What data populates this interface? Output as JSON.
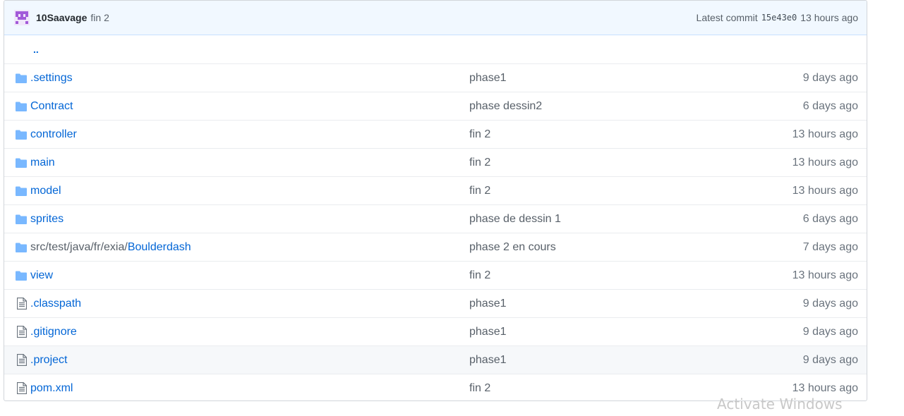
{
  "commit": {
    "author": "10Saavage",
    "message": "fin 2",
    "latest_label": "Latest commit",
    "sha": "15e43e0",
    "age": "13 hours ago"
  },
  "parent_dir": "..",
  "entries": [
    {
      "type": "dir",
      "name": ".settings",
      "message": "phase1",
      "age": "9 days ago"
    },
    {
      "type": "dir",
      "name": "Contract",
      "message": "phase dessin2",
      "age": "6 days ago"
    },
    {
      "type": "dir",
      "name": "controller",
      "message": "fin 2",
      "age": "13 hours ago"
    },
    {
      "type": "dir",
      "name": "main",
      "message": "fin 2",
      "age": "13 hours ago"
    },
    {
      "type": "dir",
      "name": "model",
      "message": "fin 2",
      "age": "13 hours ago"
    },
    {
      "type": "dir",
      "name": "sprites",
      "message": "phase de dessin 1",
      "age": "6 days ago"
    },
    {
      "type": "dir",
      "name_prefix": "src/test/java/fr/exia/",
      "name": "Boulderdash",
      "message": "phase 2 en cours",
      "age": "7 days ago"
    },
    {
      "type": "dir",
      "name": "view",
      "message": "fin 2",
      "age": "13 hours ago"
    },
    {
      "type": "file",
      "name": ".classpath",
      "message": "phase1",
      "age": "9 days ago"
    },
    {
      "type": "file",
      "name": ".gitignore",
      "message": "phase1",
      "age": "9 days ago"
    },
    {
      "type": "file",
      "name": ".project",
      "message": "phase1",
      "age": "9 days ago"
    },
    {
      "type": "file",
      "name": "pom.xml",
      "message": "fin 2",
      "age": "13 hours ago"
    }
  ],
  "watermark": "Activate Windows",
  "colors": {
    "link": "#0366d6",
    "folder_icon": "#79b8ff",
    "file_icon": "#6a737d",
    "commit_bar": "#f1f8ff",
    "avatar": "#a259d9"
  }
}
